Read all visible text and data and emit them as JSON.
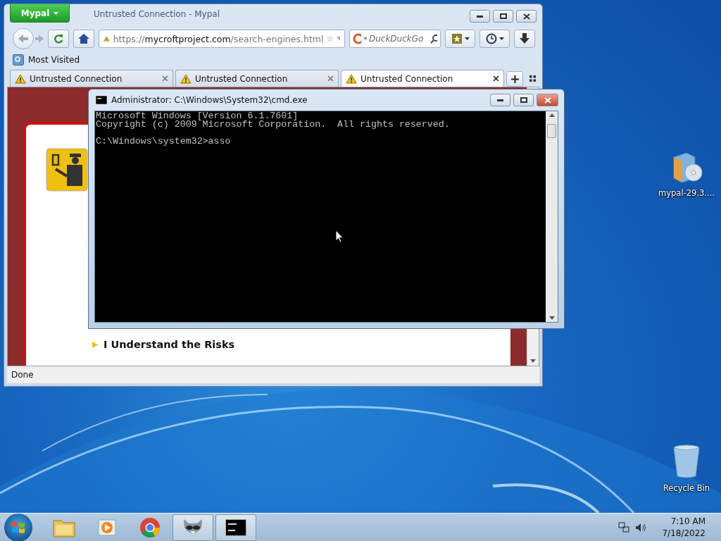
{
  "browser": {
    "app_button": "Mypal",
    "title": "Untrusted Connection - Mypal",
    "url": {
      "prefix": "https://",
      "domain": "mycroftproject.com",
      "path": "/search-engines.html"
    },
    "search": {
      "placeholder": "DuckDuckGo"
    },
    "bookmarks": [
      "Most Visited"
    ],
    "tabs": [
      {
        "label": "Untrusted Connection",
        "selected": false
      },
      {
        "label": "Untrusted Connection",
        "selected": false
      },
      {
        "label": "Untrusted Connection",
        "selected": true
      }
    ],
    "page": {
      "link": "I Understand the Risks"
    },
    "status_bar": "Done"
  },
  "console": {
    "title": "Administrator: C:\\Windows\\System32\\cmd.exe",
    "output": [
      "Microsoft Windows [Version 6.1.7601]",
      "Copyright (c) 2009 Microsoft Corporation.  All rights reserved."
    ],
    "prompt": "C:\\Windows\\system32>asso"
  },
  "desktop_icons": [
    {
      "label": "mypal-29.3....",
      "kind": "installer"
    },
    {
      "label": "Recycle Bin",
      "kind": "recycle-bin"
    }
  ],
  "taskbar": {
    "apps": [
      {
        "kind": "explorer",
        "selected": false
      },
      {
        "kind": "media",
        "selected": false
      },
      {
        "kind": "chrome",
        "selected": false
      },
      {
        "kind": "mypal",
        "selected": true
      },
      {
        "kind": "cmd",
        "selected": true
      }
    ],
    "time": "7:10 AM",
    "date": "7/18/2022"
  }
}
